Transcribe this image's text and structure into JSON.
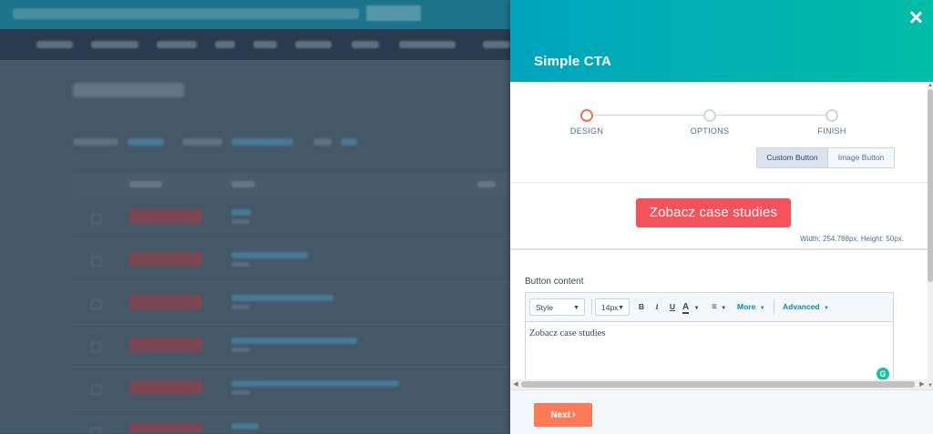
{
  "panel": {
    "title": "Simple CTA",
    "close_icon": "close-icon"
  },
  "steps": [
    {
      "label": "DESIGN",
      "active": true
    },
    {
      "label": "OPTIONS",
      "active": false
    },
    {
      "label": "FINISH",
      "active": false
    }
  ],
  "button_type": {
    "options": [
      "Custom Button",
      "Image Button"
    ],
    "selected": "Custom Button"
  },
  "preview": {
    "cta_label": "Zobacz case studies",
    "cta_color": "#f5535b",
    "dimensions": "Width: 254.788px. Height: 50px."
  },
  "editor": {
    "section_label": "Button content",
    "toolbar": {
      "style_select": "Style",
      "size_select": "14px",
      "bold": "B",
      "italic": "I",
      "underline": "U",
      "font_color": "A",
      "align_icon": "align-left-icon",
      "more": "More",
      "advanced": "Advanced"
    },
    "content": "Zobacz case studies",
    "grammarly_icon": "G"
  },
  "footer": {
    "next_label": "Next"
  },
  "colors": {
    "header_gradient_start": "#00a4bd",
    "header_gradient_end": "#00bda5",
    "active_step": "#f2754e",
    "next_button": "#ff7a59",
    "link": "#0091ae"
  }
}
